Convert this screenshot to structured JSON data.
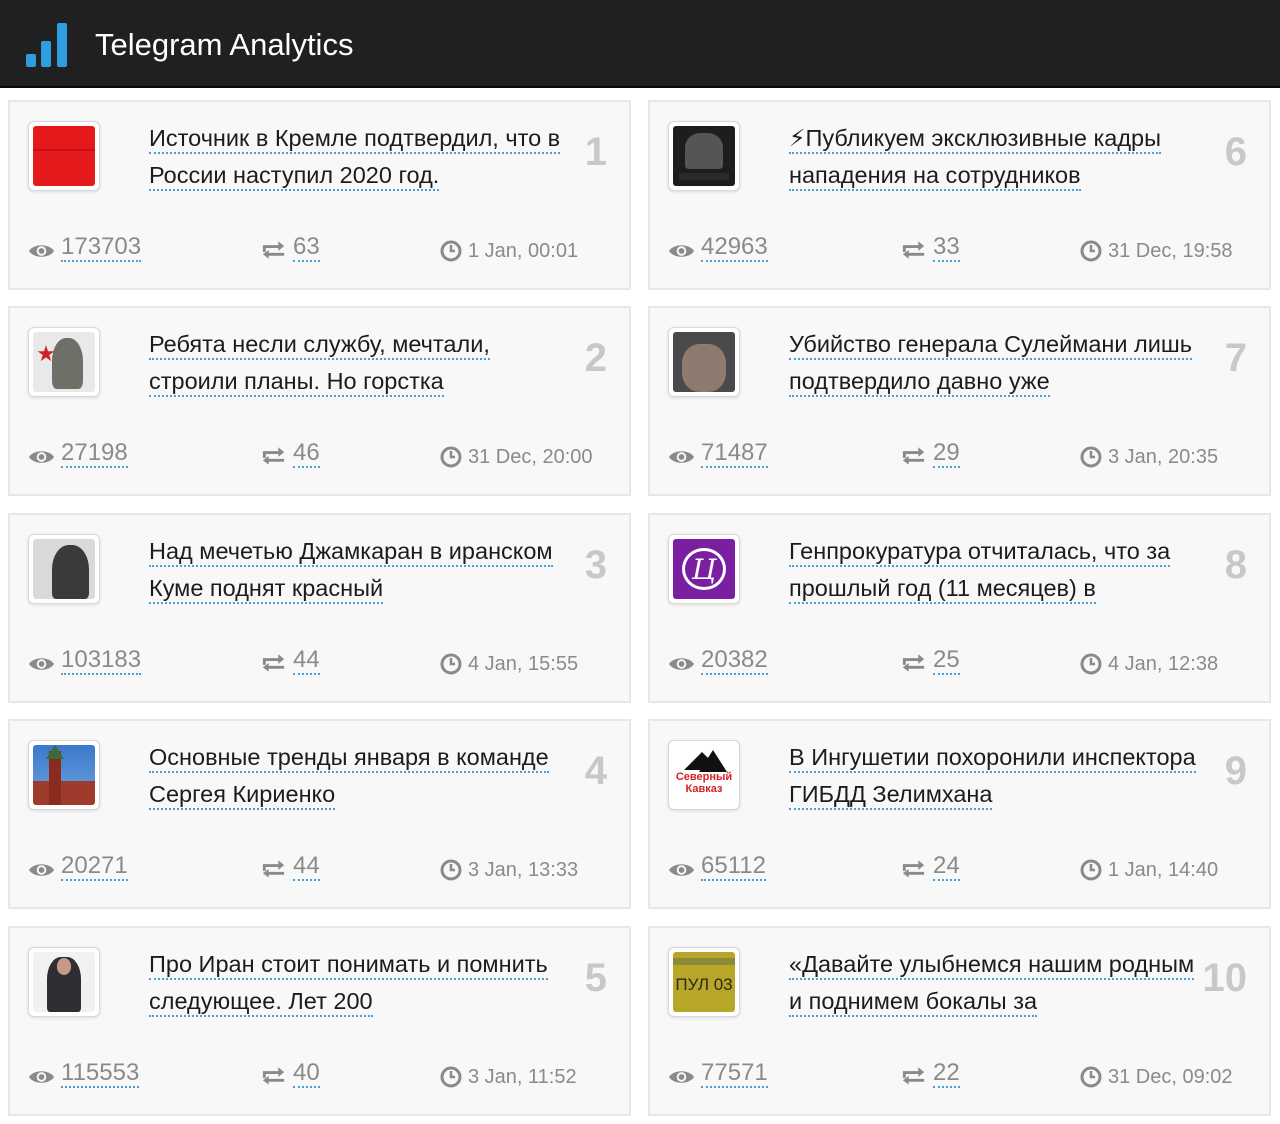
{
  "header": {
    "title": "Telegram Analytics",
    "logo_icon": "bar-chart-icon",
    "brand_color": "#2d9ee0"
  },
  "posts": [
    {
      "rank": "1",
      "title": "Источник в Кремле подтвердил, что в России наступил 2020 год.",
      "views": "173703",
      "shares": "63",
      "date": "1 Jan, 00:01",
      "thumb": "red"
    },
    {
      "rank": "6",
      "title": "⚡Публикуем эксклюзивные кадры нападения на сотрудников",
      "views": "42963",
      "shares": "33",
      "date": "31 Dec, 19:58",
      "thumb": "dark"
    },
    {
      "rank": "2",
      "title": "Ребята несли службу, мечтали, строили планы. Но горстка",
      "views": "27198",
      "shares": "46",
      "date": "31 Dec, 20:00",
      "thumb": "soldier"
    },
    {
      "rank": "7",
      "title": "Убийство генерала Сулеймани лишь подтвердило давно уже",
      "views": "71487",
      "shares": "29",
      "date": "3 Jan, 20:35",
      "thumb": "face"
    },
    {
      "rank": "3",
      "title": "Над мечетью Джамкаран в иранском Куме поднят красный",
      "views": "103183",
      "shares": "44",
      "date": "4 Jan, 15:55",
      "thumb": "smoke"
    },
    {
      "rank": "8",
      "title": "Генпрокуратура отчиталась, что за прошлый год (11 месяцев) в",
      "views": "20382",
      "shares": "25",
      "date": "4 Jan, 12:38",
      "thumb": "purple"
    },
    {
      "rank": "4",
      "title": "Основные тренды января в команде Сергея Кириенко",
      "views": "20271",
      "shares": "44",
      "date": "3 Jan, 13:33",
      "thumb": "kremlin"
    },
    {
      "rank": "9",
      "title": "В Ингушетии похоронили инспектора ГИБДД Зелимхана",
      "views": "65112",
      "shares": "24",
      "date": "1 Jan, 14:40",
      "thumb": "caucasus",
      "thumb_text": "Северный Кавказ"
    },
    {
      "rank": "5",
      "title": "Про Иран стоит понимать и помнить следующее. Лет 200",
      "views": "115553",
      "shares": "40",
      "date": "3 Jan, 11:52",
      "thumb": "man"
    },
    {
      "rank": "10",
      "title": "«Давайте улыбнемся нашим родным и поднимем бокалы за",
      "views": "77571",
      "shares": "22",
      "date": "31 Dec, 09:02",
      "thumb": "yellow",
      "thumb_text": "ПУЛ 03"
    }
  ],
  "icons": {
    "views": "eye-icon",
    "shares": "repost-icon",
    "date": "clock-icon"
  },
  "colors": {
    "link_underline": "#4a9fd8",
    "rank": "#c8c8c8",
    "stat_text": "#8a8a8a"
  }
}
